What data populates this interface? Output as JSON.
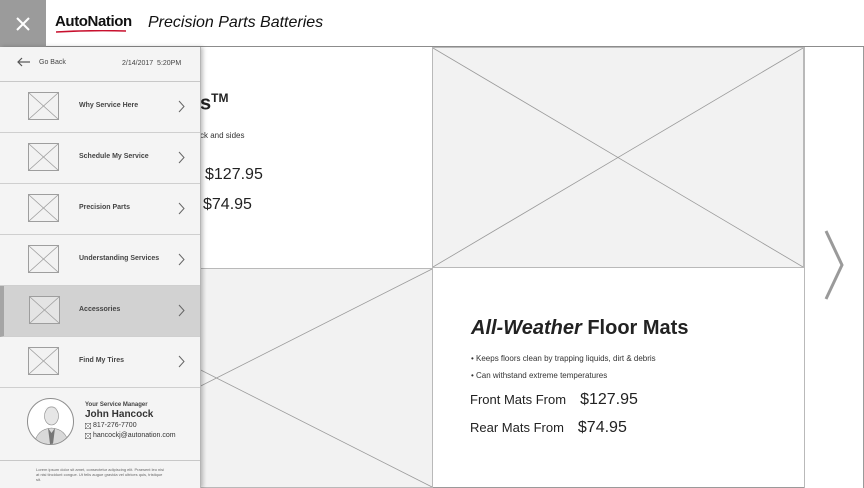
{
  "header": {
    "logo_text": "AutoNation",
    "title": "Precision Parts Batteries"
  },
  "sidebar": {
    "back_label": "Go Back",
    "date": "2/14/2017",
    "time": "5:20PM",
    "items": [
      {
        "label": "Why Service Here",
        "active": false
      },
      {
        "label": "Schedule My Service",
        "active": false
      },
      {
        "label": "Precision Parts",
        "active": false
      },
      {
        "label": "Understanding Services",
        "active": false
      },
      {
        "label": "Accessories",
        "active": true
      },
      {
        "label": "Find My Tires",
        "active": false
      }
    ],
    "manager": {
      "role": "Your Service Manager",
      "name": "John Hancock",
      "phone": "817-276-7700",
      "email": "hancockj@autonation.com"
    },
    "legal_text": "Lorem ipsum dolor sit amet, consectetur adipiscing elit. Praesent leo nisi at nisi tincidunt congue. Ut felis augue gravida vel ultrices quis, tristique sit."
  },
  "top_card": {
    "title_fragment": "s",
    "title_tm": "TM",
    "bullet_fragment": "ck and sides",
    "price1_value": "$127.95",
    "price2_value": "$74.95"
  },
  "mats_card": {
    "title_italic": "All-Weather",
    "title_rest": " Floor Mats",
    "bullets": [
      "• Keeps floors clean by trapping liquids, dirt & debris",
      "• Can withstand extreme temperatures"
    ],
    "front_label": "Front Mats From",
    "front_value": "$127.95",
    "rear_label": "Rear Mats From",
    "rear_value": "$74.95"
  },
  "icons": {
    "close": "close-icon",
    "back": "arrow-left-icon",
    "chevron": "chevron-right-icon",
    "next": "chevron-right-large-icon",
    "phone": "phone-icon",
    "email": "email-icon",
    "avatar": "person-avatar-icon"
  },
  "colors": {
    "close_bg": "#9b9b9b",
    "active_item_bg": "#d2d2d2",
    "placeholder_bg": "#f2f2f2",
    "logo_swoosh": "#c8102e"
  }
}
